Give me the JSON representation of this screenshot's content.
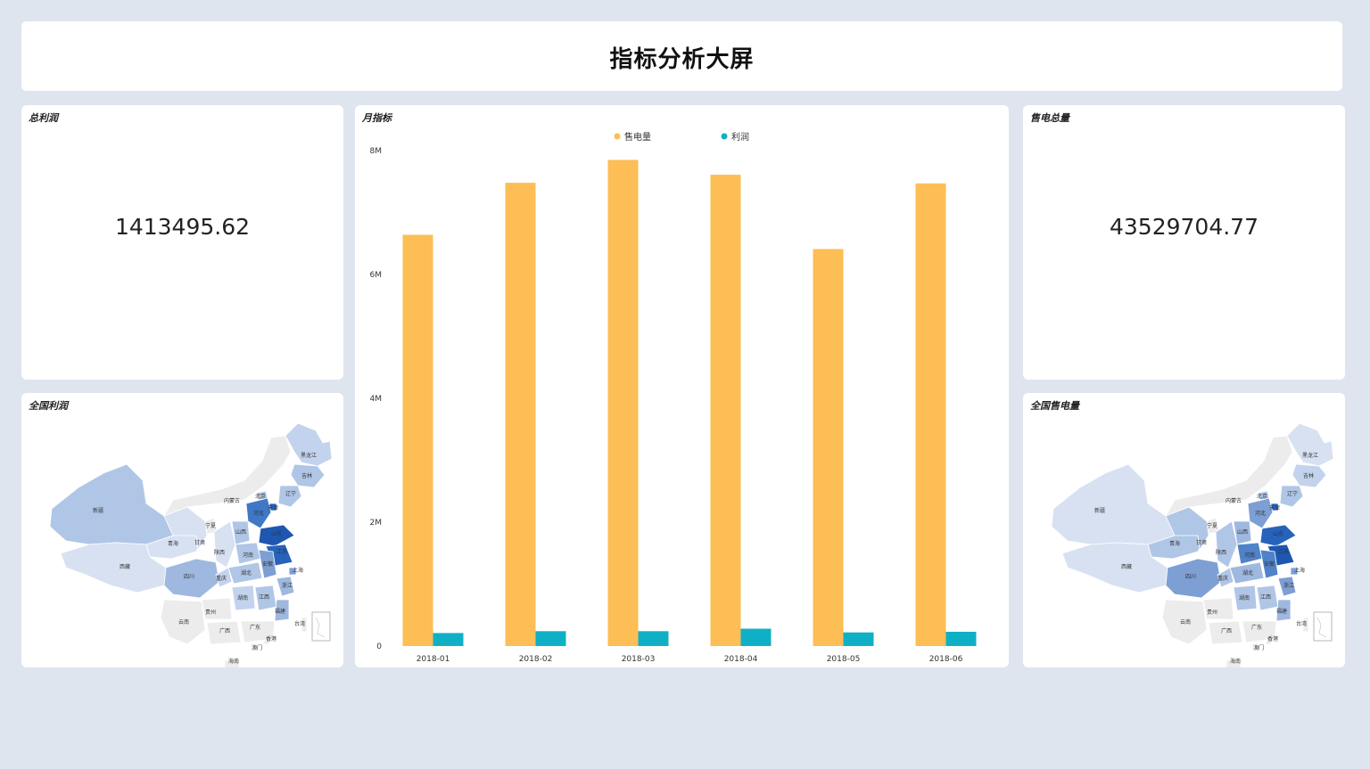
{
  "header": {
    "title": "指标分析大屏"
  },
  "profit_total": {
    "title": "总利润",
    "value": "1413495.62"
  },
  "sales_total": {
    "title": "售电总量",
    "value": "43529704.77"
  },
  "map_profit": {
    "title": "全国利润"
  },
  "map_sales": {
    "title": "全国售电量"
  },
  "monthly": {
    "title": "月指标"
  },
  "chart_data": {
    "type": "bar",
    "categories": [
      "2018-01",
      "2018-02",
      "2018-03",
      "2018-04",
      "2018-05",
      "2018-06"
    ],
    "series": [
      {
        "name": "售电量",
        "color": "#fdbe55",
        "values": [
          6640000,
          7480000,
          7850000,
          7610000,
          6410000,
          7470000
        ]
      },
      {
        "name": "利润",
        "color": "#0fb0c6",
        "values": [
          210000,
          240000,
          240000,
          280000,
          220000,
          230000
        ]
      }
    ],
    "y_ticks": [
      "0",
      "2M",
      "4M",
      "6M",
      "8M"
    ],
    "ylim": [
      0,
      8000000
    ],
    "legend_position": "top",
    "grid": false
  },
  "map_labels": [
    "黑龙江",
    "吉林",
    "辽宁",
    "内蒙古",
    "北京",
    "天津",
    "河北",
    "新疆",
    "宁夏",
    "山西",
    "青海",
    "甘肃",
    "陕西",
    "河南",
    "山东",
    "江苏",
    "西藏",
    "四川",
    "重庆",
    "湖北",
    "安徽",
    "上海",
    "浙江",
    "湖南",
    "江西",
    "贵州",
    "福建",
    "云南",
    "广西",
    "广东",
    "台湾",
    "香港",
    "澳门",
    "海南"
  ]
}
